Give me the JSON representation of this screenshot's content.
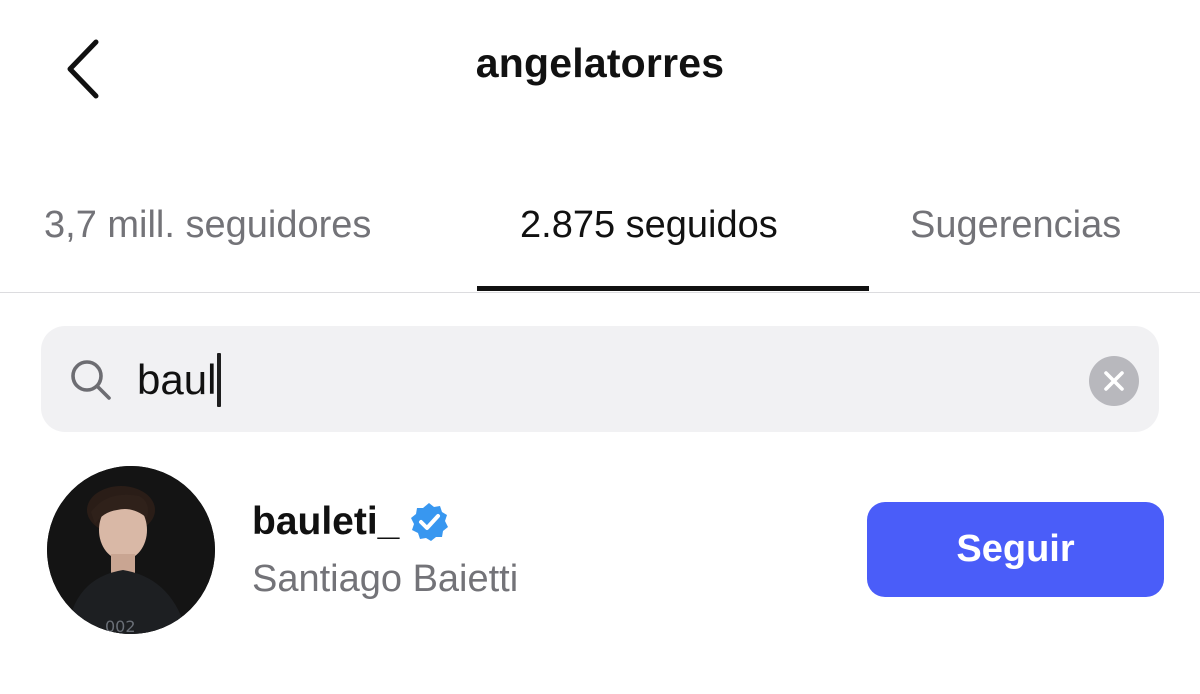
{
  "header": {
    "title": "angelatorres",
    "back_icon": "chevron-left-icon"
  },
  "tabs": [
    {
      "label": "3,7 mill. seguidores",
      "active": false
    },
    {
      "label": "2.875 seguidos",
      "active": true
    },
    {
      "label": "Sugerencias",
      "active": false
    }
  ],
  "search": {
    "value": "baul",
    "icon": "search-icon",
    "clear_icon": "clear-icon"
  },
  "results": [
    {
      "username": "bauleti_",
      "verified": true,
      "full_name": "Santiago Baietti",
      "action_label": "Seguir"
    }
  ],
  "colors": {
    "accent": "#4a5df9",
    "verified": "#3897f0",
    "muted_text": "#737378",
    "search_bg": "#f1f1f3"
  }
}
